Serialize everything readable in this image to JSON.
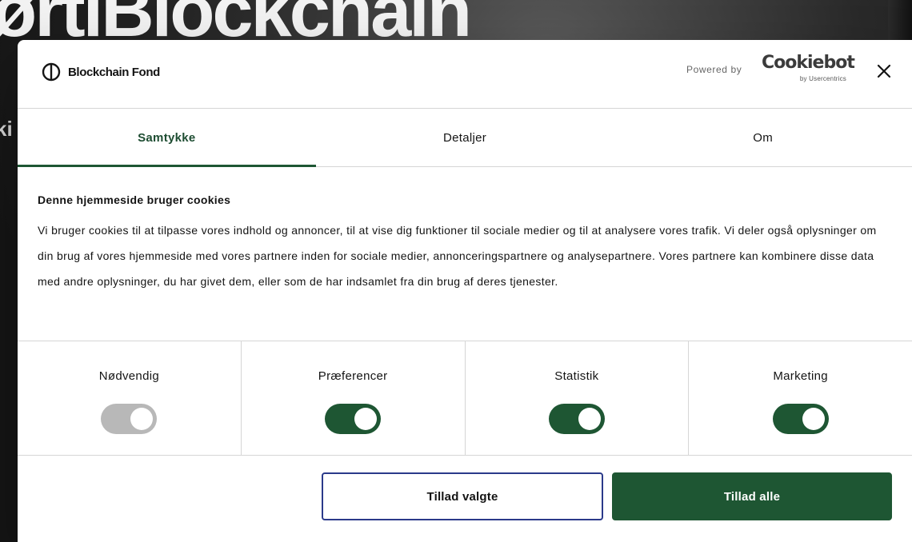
{
  "background": {
    "headline": "ørtiBlockchain",
    "sub_fragment": "ki"
  },
  "header": {
    "brand_name": "Blockchain Fond",
    "powered_by": "Powered by",
    "cookiebot_word": "Cookiebot",
    "cookiebot_by": "by Usercentrics",
    "close_icon": "close-icon"
  },
  "tabs": [
    {
      "label": "Samtykke",
      "active": true
    },
    {
      "label": "Detaljer",
      "active": false
    },
    {
      "label": "Om",
      "active": false
    }
  ],
  "content": {
    "title": "Denne hjemmeside bruger cookies",
    "text": "Vi bruger cookies til at tilpasse vores indhold og annoncer, til at vise dig funktioner til sociale medier og til at analysere vores trafik. Vi deler også oplysninger om din brug af vores hjemmeside med vores partnere inden for sociale medier, annonceringspartnere og analysepartnere. Vores partnere kan kombinere disse data med andre oplysninger, du har givet dem, eller som de har indsamlet fra din brug af deres tjenester."
  },
  "categories": [
    {
      "label": "Nødvendig",
      "enabled": true,
      "locked": true
    },
    {
      "label": "Præferencer",
      "enabled": true,
      "locked": false
    },
    {
      "label": "Statistik",
      "enabled": true,
      "locked": false
    },
    {
      "label": "Marketing",
      "enabled": true,
      "locked": false
    }
  ],
  "footer": {
    "allow_selected": "Tillad valgte",
    "allow_all": "Tillad alle"
  },
  "colors": {
    "accent_green": "#1e5633",
    "toggle_disabled": "#b8b8b8",
    "outline_button_border": "#2b3a8a"
  }
}
